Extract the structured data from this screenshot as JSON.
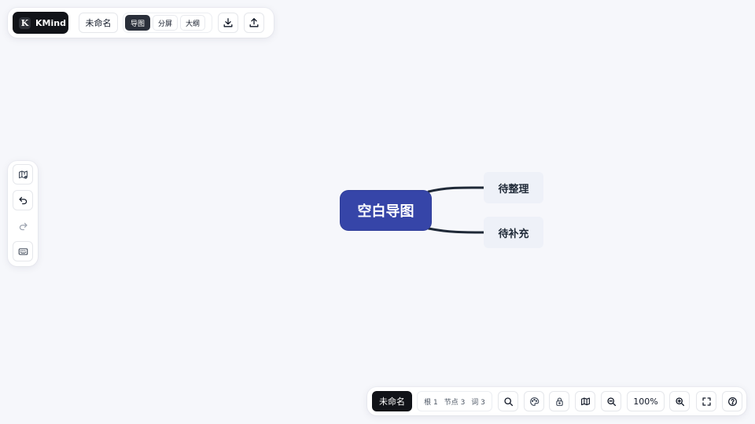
{
  "app": {
    "brand_letter": "K",
    "brand_name": "KMind"
  },
  "top_toolbar": {
    "doc_title": "未命名",
    "view_modes": [
      {
        "label": "导图",
        "active": true
      },
      {
        "label": "分屏",
        "active": false
      },
      {
        "label": "大纲",
        "active": false
      }
    ],
    "download_icon": "download-icon",
    "upload_icon": "upload-icon"
  },
  "left_toolbar": {
    "icons": [
      "map-settings-icon",
      "undo-icon",
      "redo-icon",
      "keyboard-icon"
    ]
  },
  "mindmap": {
    "root": "空白导图",
    "children": [
      "待整理",
      "待补充"
    ],
    "root_color": "#3645a8",
    "child_color": "#eef1f8",
    "edge_color": "#1f2937"
  },
  "bottom_toolbar": {
    "doc_name": "未命名",
    "stats": {
      "roots": "根 1",
      "nodes": "节点 3",
      "words": "词 3"
    },
    "zoom": "100%",
    "icons": [
      "search-icon",
      "theme-icon",
      "lock-icon",
      "map-icon",
      "zoom-out-icon",
      "zoom-in-icon",
      "fullscreen-icon",
      "help-icon"
    ]
  }
}
